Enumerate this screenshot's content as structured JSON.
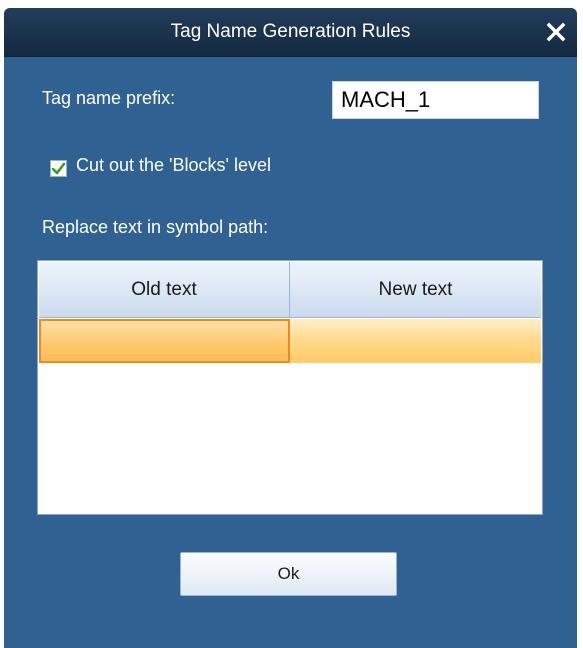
{
  "dialog": {
    "title": "Tag Name Generation Rules",
    "close_icon": "close-icon"
  },
  "prefix": {
    "label": "Tag name prefix:",
    "value": "MACH_1"
  },
  "cut_blocks": {
    "label": "Cut out the 'Blocks' level",
    "checked": true
  },
  "replace": {
    "label": "Replace text in symbol path:",
    "columns": [
      "Old text",
      "New text"
    ],
    "rows": [
      {
        "old_text": "",
        "new_text": ""
      }
    ]
  },
  "buttons": {
    "ok_label": "Ok"
  },
  "colors": {
    "dialog_background": "#2f6193",
    "title_bar": "#19314a",
    "selected_row": "#ffd98a",
    "active_cell_border": "#f08a1d",
    "checkmark": "#3a9a2e"
  }
}
